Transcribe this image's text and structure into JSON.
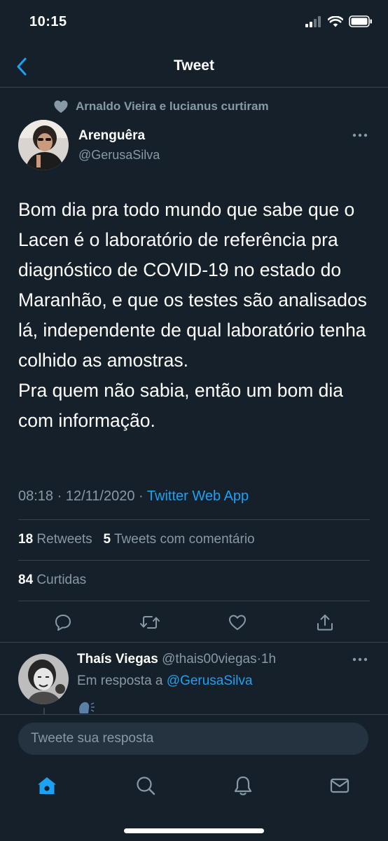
{
  "status_bar": {
    "time": "10:15"
  },
  "header": {
    "title": "Tweet"
  },
  "social_context": {
    "text": "Arnaldo Vieira e lucianus curtiram"
  },
  "tweet": {
    "author_name": "Arenguêra",
    "author_handle": "@GerusaSilva",
    "text": "Bom dia pra todo mundo que sabe que o Lacen é o laboratório de referência pra diagnóstico de COVID-19 no estado do Maranhão, e que os testes são analisados lá, independente de qual laboratório tenha colhido as amostras.\nPra quem não sabia, então um bom dia com informação.",
    "time": "08:18",
    "date": "12/11/2020",
    "separator": "·",
    "source": "Twitter Web App",
    "retweets_count": "18",
    "retweets_label": "Retweets",
    "quotes_count": "5",
    "quotes_label": "Tweets com comentário",
    "likes_count": "84",
    "likes_label": "Curtidas"
  },
  "reply": {
    "author_name": "Thaís Viegas",
    "author_handle": "@thais00viegas",
    "separator": "·",
    "age": "1h",
    "reply_prefix": "Em resposta a",
    "reply_mention": "@GerusaSilva"
  },
  "composer": {
    "placeholder": "Tweete sua resposta"
  },
  "icons": {
    "back": "chevron-left-icon",
    "more": "more-horizontal-icon",
    "reply": "comment-icon",
    "retweet": "retweet-icon",
    "like": "heart-icon",
    "share": "share-icon",
    "home": "home-icon",
    "search": "search-icon",
    "notifications": "bell-icon",
    "messages": "mail-icon"
  },
  "colors": {
    "background": "#15202b",
    "accent": "#1da1f2",
    "secondary_text": "#8899a6",
    "divider": "#38444d"
  }
}
